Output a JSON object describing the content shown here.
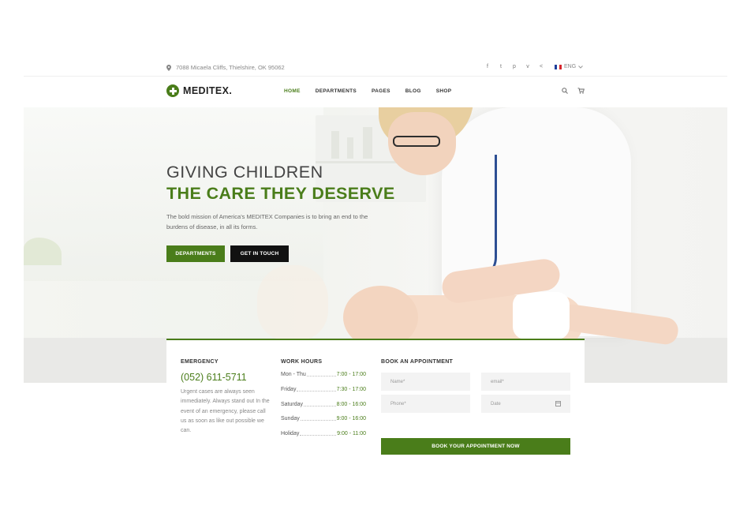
{
  "topbar": {
    "address": "7088 Micaela Cliffs, Thielshire, OK 95062",
    "social": [
      "f",
      "t",
      "p",
      "v",
      "<"
    ],
    "language": "ENG"
  },
  "header": {
    "logo_text": "MEDITEX",
    "logo_dot": ".",
    "nav": [
      "HOME",
      "DEPARTMENTS",
      "PAGES",
      "BLOG",
      "SHOP"
    ],
    "active_nav": "HOME"
  },
  "hero": {
    "title_line1": "GIVING CHILDREN",
    "title_line2": "THE CARE THEY DESERVE",
    "description": "The bold mission of America's MEDITEX Companies is to bring an end to the burdens of disease, in all its forms.",
    "btn_primary": "DEPARTMENTS",
    "btn_secondary": "GET IN TOUCH"
  },
  "emergency": {
    "heading": "EMERGENCY",
    "phone": "(052) 611-5711",
    "text": "Urgent cases are always seen immediately. Always stand out In the event of an emergency, please call us as soon as like out possible we can."
  },
  "hours": {
    "heading": "WORK HOURS",
    "rows": [
      {
        "day": "Mon - Thu",
        "time": "7:00 - 17:00"
      },
      {
        "day": "Friday",
        "time": "7:30 - 17:00"
      },
      {
        "day": "Saturday",
        "time": "8:00 - 16:00"
      },
      {
        "day": "Sunday",
        "time": "9:00 - 16:00"
      },
      {
        "day": "Holiday",
        "time": "9:00 - 11:00"
      }
    ]
  },
  "booking": {
    "heading": "BOOK AN APPOINTMENT",
    "name_placeholder": "Name*",
    "email_placeholder": "email*",
    "phone_placeholder": "Phone*",
    "date_placeholder": "Date",
    "button": "BOOK YOUR APPOINTMENT NOW"
  },
  "colors": {
    "accent": "#4a7d1a",
    "dark_button": "#111111"
  }
}
